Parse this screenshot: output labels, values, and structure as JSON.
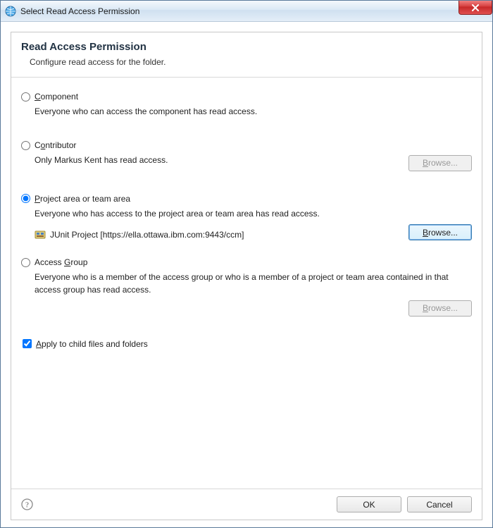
{
  "titlebar": {
    "title": "Select Read Access Permission"
  },
  "header": {
    "title": "Read Access Permission",
    "subtitle": "Configure read access for the folder."
  },
  "options": {
    "component": {
      "label_pre": "",
      "mnemonic": "C",
      "label_post": "omponent",
      "desc": "Everyone who can access the component has read access."
    },
    "contributor": {
      "label_pre": "C",
      "mnemonic": "o",
      "label_post": "ntributor",
      "desc": "Only Markus Kent has read access.",
      "browse_label_pre": "",
      "browse_mnemonic": "B",
      "browse_label_post": "rowse..."
    },
    "project": {
      "label_pre": "",
      "mnemonic": "P",
      "label_post": "roject area or team area",
      "desc": "Everyone who has access to the project area or team area has read access.",
      "entry": "JUnit Project [https://ella.ottawa.ibm.com:9443/ccm]",
      "browse_label_pre": "",
      "browse_mnemonic": "B",
      "browse_label_post": "rowse..."
    },
    "group": {
      "label_pre": "Access ",
      "mnemonic": "G",
      "label_post": "roup",
      "desc": "Everyone who is a member of the access group or who is a member of a project or team area contained in that access group has read access.",
      "browse_label_pre": "",
      "browse_mnemonic": "B",
      "browse_label_post": "rowse..."
    }
  },
  "checkbox": {
    "label_pre": "",
    "mnemonic": "A",
    "label_post": "pply to child files and folders"
  },
  "footer": {
    "ok": "OK",
    "cancel": "Cancel"
  },
  "state": {
    "selected": "project",
    "apply_checked": true
  }
}
